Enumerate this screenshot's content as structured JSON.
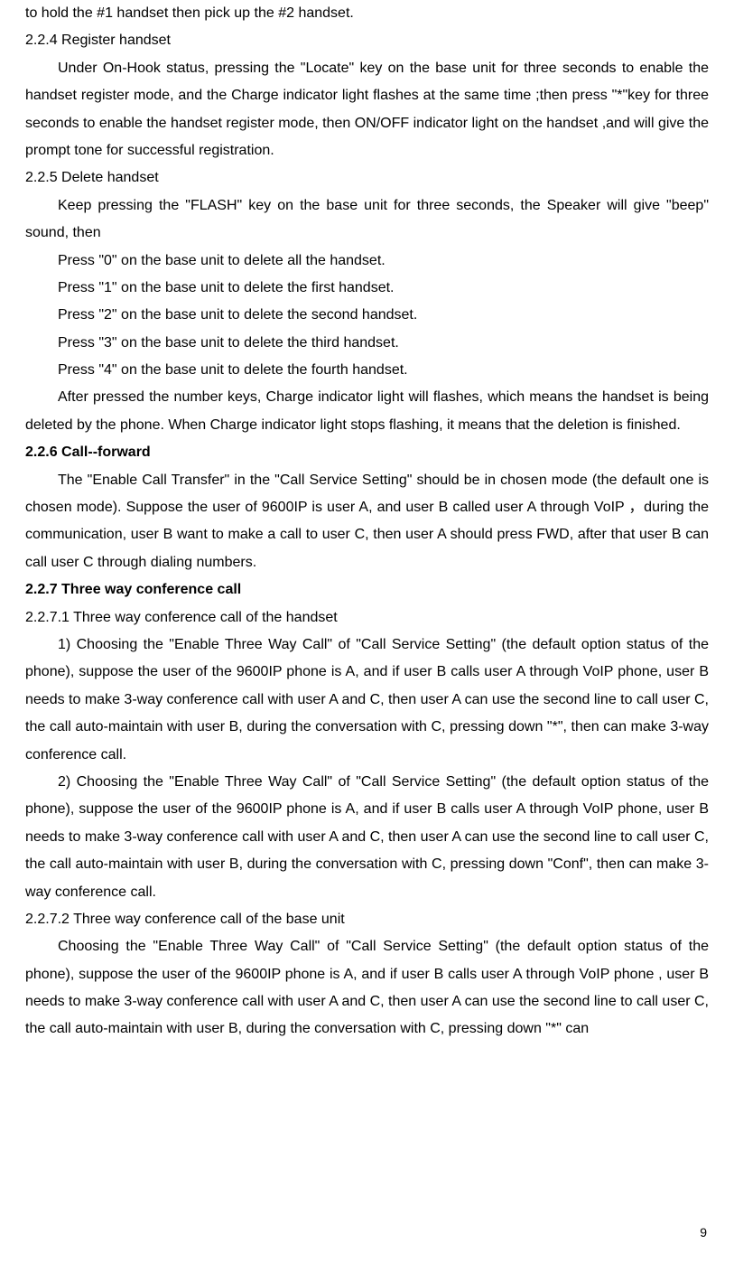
{
  "lines": {
    "l1": "to hold the #1 handset then pick up the #2 handset.",
    "l2": "2.2.4 Register handset",
    "l3": "Under On-Hook status, pressing the \"Locate\" key on the base unit for three seconds to enable the handset register mode, and the Charge indicator light flashes at the same time ;then press \"*\"key for three seconds to enable the handset register mode, then ON/OFF indicator light on the handset ,and will give the prompt tone for successful registration.",
    "l4": "2.2.5 Delete handset",
    "l5": "Keep pressing the \"FLASH\" key on the base unit for three seconds, the Speaker will give \"beep\" sound, then",
    "l6": "Press \"0\" on the base unit to delete all the handset.",
    "l7": "Press \"1\" on the base unit to delete the first handset.",
    "l8": "Press \"2\" on the base unit to delete the second handset.",
    "l9": "Press \"3\" on the base unit to delete the third handset.",
    "l10": "Press \"4\" on the base unit to delete the fourth handset.",
    "l11": "After pressed the number keys, Charge indicator light will flashes, which means the handset is being deleted by the phone. When Charge indicator light stops flashing, it means that the deletion is finished.",
    "l12": "2.2.6 Call--forward",
    "l13": "The \"Enable Call Transfer\" in the \"Call Service Setting\" should be in chosen mode (the default one is chosen mode). Suppose the user of 9600IP is user A, and user B called user A through VoIP ，during the communication, user B want to make a call to user C, then user A should press FWD, after that user B can call user C through dialing numbers.",
    "l14": "2.2.7 Three way conference call",
    "l15": "2.2.7.1 Three way conference call of the handset",
    "l16": "1) Choosing the \"Enable Three Way Call\" of \"Call Service Setting\" (the default option status of the phone), suppose the user of the 9600IP phone is A, and if user B calls user A through VoIP phone, user B needs to make 3-way conference call with user A and C, then user A can use the second line to call user C, the call auto-maintain with user B, during the conversation with C, pressing down \"*\", then can make 3-way conference call.",
    "l17": "2) Choosing the \"Enable Three Way Call\" of \"Call Service Setting\" (the default option status of the phone), suppose the user of the 9600IP phone is A, and if user B calls user A through VoIP phone, user B needs to make 3-way conference call with user A and C, then user A can use the second line to call user C, the call auto-maintain with user B, during the conversation with C, pressing down \"Conf\", then can make 3-way conference call.",
    "l18": "2.2.7.2 Three way conference call of the base unit",
    "l19": "Choosing the \"Enable Three Way Call\" of \"Call Service Setting\" (the default option status of the phone), suppose the user of the 9600IP phone is A, and if user B calls user A through VoIP phone , user B needs to make 3-way conference call with user A and C, then user A can use the second line to call user C, the call auto-maintain with user B, during the conversation with C, pressing down \"*\" can",
    "pagenum": "9"
  }
}
